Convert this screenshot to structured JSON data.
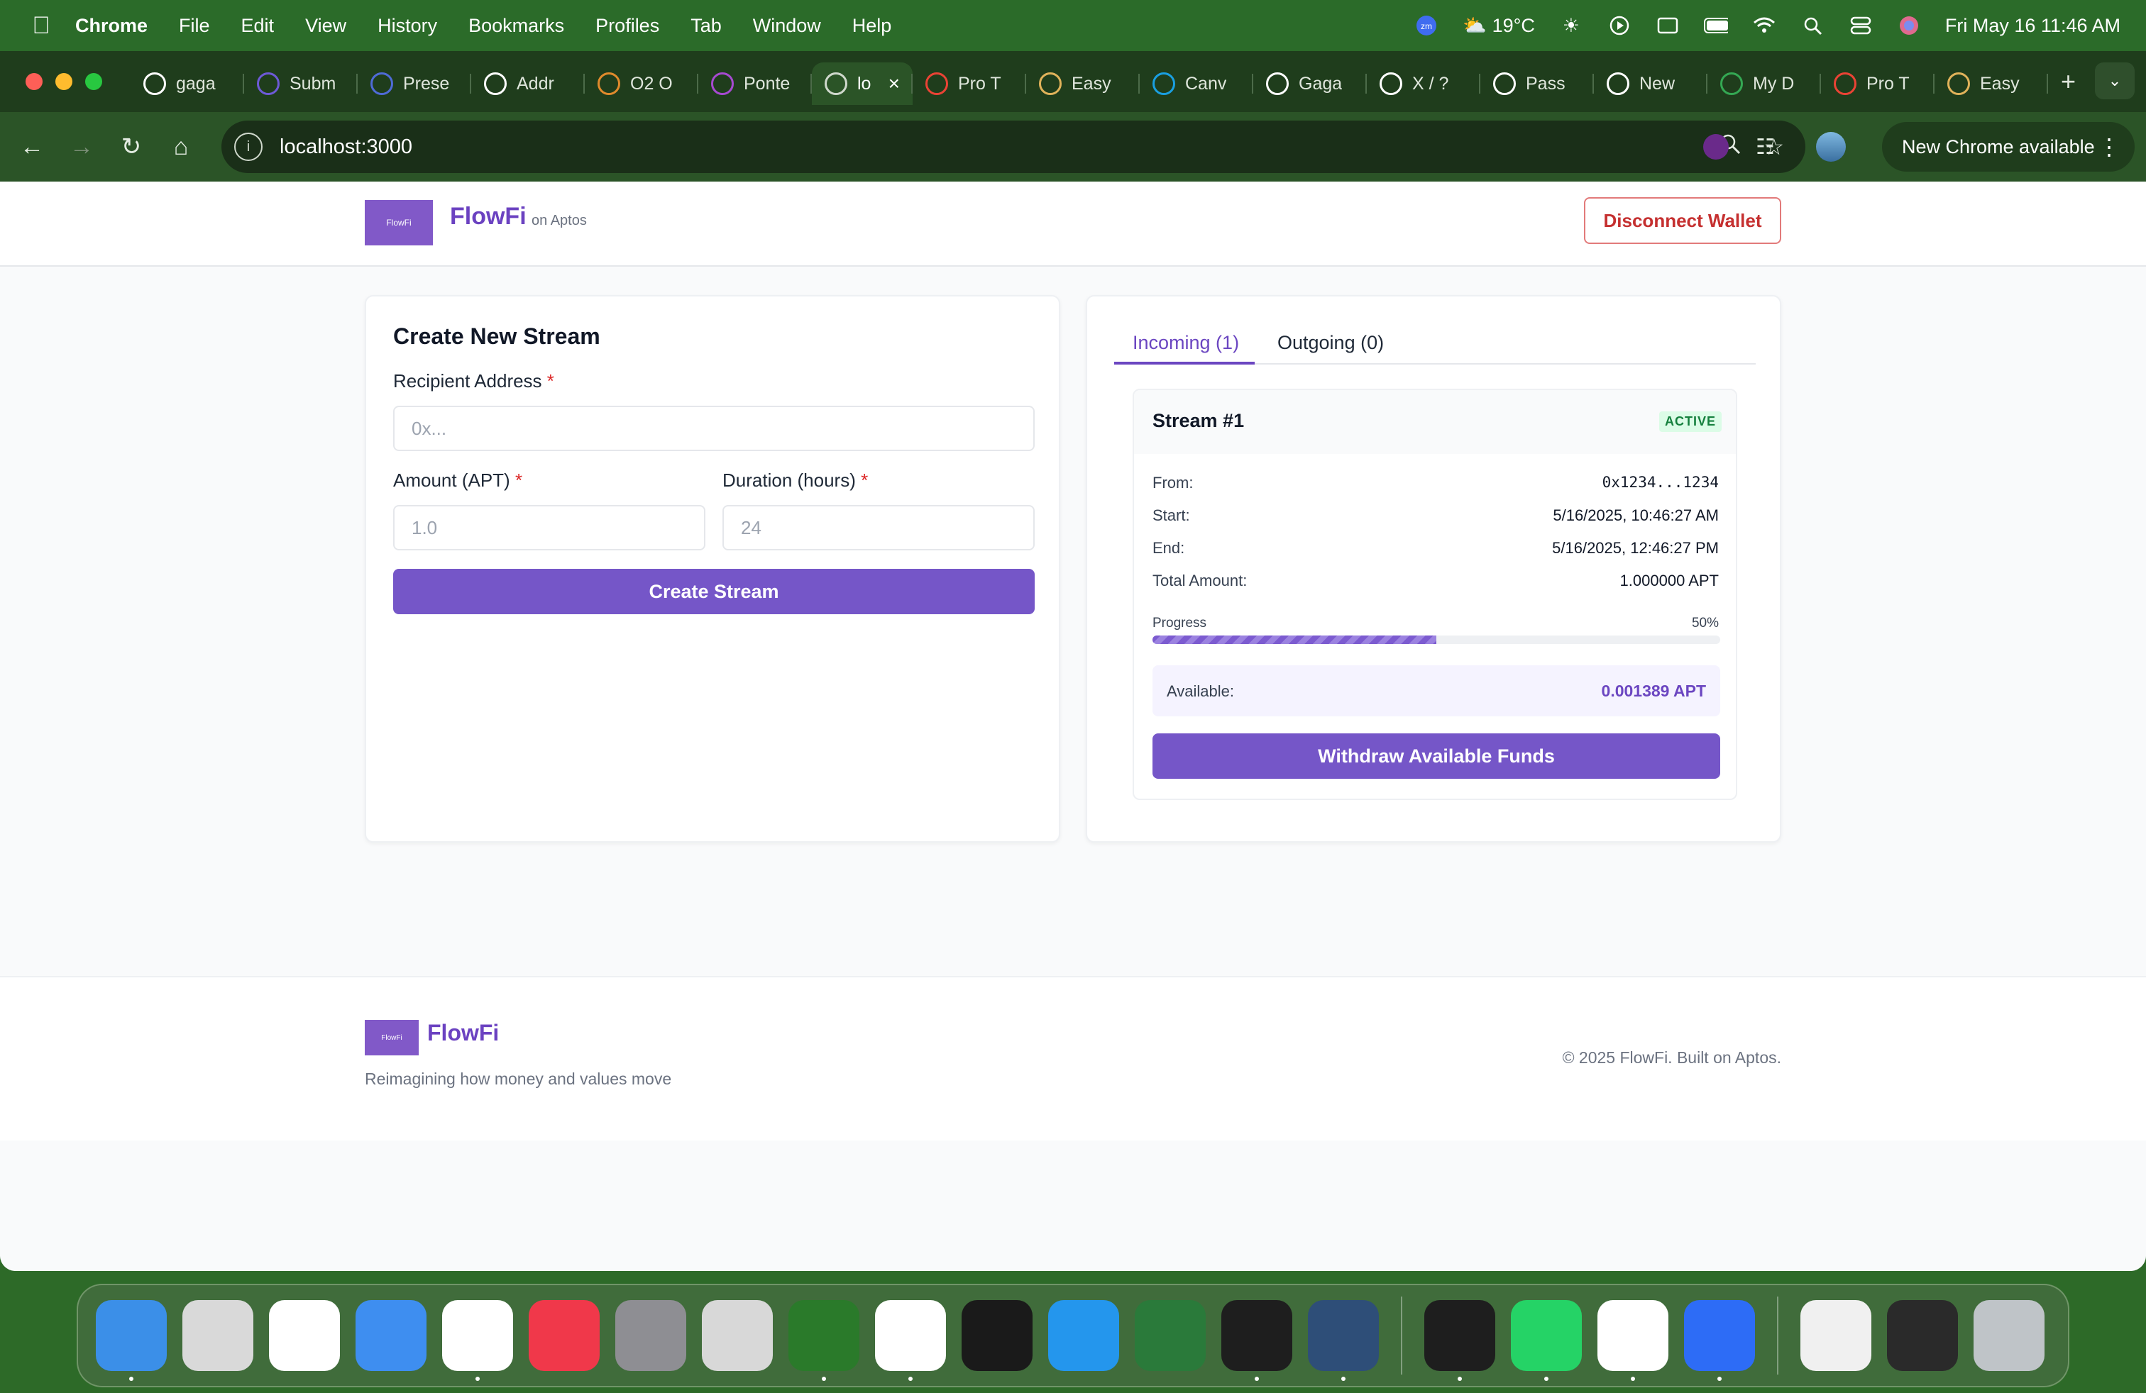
{
  "menubar": {
    "app": "Chrome",
    "items": [
      "File",
      "Edit",
      "View",
      "History",
      "Bookmarks",
      "Profiles",
      "Tab",
      "Window",
      "Help"
    ],
    "weather": "19°C",
    "datetime": "Fri May 16  11:46 AM"
  },
  "tabs": [
    {
      "label": "gaga",
      "icon": "github-icon",
      "color": "#ffffff"
    },
    {
      "label": "Subm",
      "icon": "form-icon",
      "color": "#6d5ad6"
    },
    {
      "label": "Prese",
      "icon": "slides-icon",
      "color": "#4f6bd6"
    },
    {
      "label": "Addr",
      "icon": "address-icon",
      "color": "#ffffff"
    },
    {
      "label": "O2 O",
      "icon": "o2-icon",
      "color": "#e08a2c"
    },
    {
      "label": "Ponte",
      "icon": "ponte-icon",
      "color": "#a64ad0"
    },
    {
      "label": "lo",
      "icon": "globe-icon",
      "color": "#cfd8cc",
      "active": true
    },
    {
      "label": "Pro T",
      "icon": "gmail-icon",
      "color": "#ea4335"
    },
    {
      "label": "Easy",
      "icon": "avatar-icon",
      "color": "#e0b25a"
    },
    {
      "label": "Canv",
      "icon": "canva-icon",
      "color": "#1a9fe0"
    },
    {
      "label": "Gaga",
      "icon": "x-icon",
      "color": "#ffffff"
    },
    {
      "label": "X / ?",
      "icon": "x-icon",
      "color": "#ffffff"
    },
    {
      "label": "Pass",
      "icon": "x-icon",
      "color": "#ffffff"
    },
    {
      "label": "New",
      "icon": "chrome-icon",
      "color": "#ffffff"
    },
    {
      "label": "My D",
      "icon": "drive-icon",
      "color": "#34a853"
    },
    {
      "label": "Pro T",
      "icon": "gmail-icon",
      "color": "#ea4335"
    },
    {
      "label": "Easy",
      "icon": "avatar-icon",
      "color": "#e0b25a"
    }
  ],
  "toolbar": {
    "url": "localhost:3000",
    "update_label": "New Chrome available"
  },
  "header": {
    "brand": "FlowFi",
    "sub": "on Aptos",
    "logo_text": "FlowFi",
    "disconnect_label": "Disconnect Wallet"
  },
  "create": {
    "title": "Create New Stream",
    "recipient_label": "Recipient Address",
    "recipient_placeholder": "0x...",
    "amount_label": "Amount (APT)",
    "amount_placeholder": "1.0",
    "duration_label": "Duration (hours)",
    "duration_placeholder": "24",
    "required_mark": "*",
    "submit_label": "Create Stream"
  },
  "streams": {
    "tab_incoming": "Incoming (1)",
    "tab_outgoing": "Outgoing (0)",
    "item": {
      "title": "Stream #1",
      "status": "ACTIVE",
      "from_label": "From:",
      "from_value": "0x1234...1234",
      "start_label": "Start:",
      "start_value": "5/16/2025, 10:46:27 AM",
      "end_label": "End:",
      "end_value": "5/16/2025, 12:46:27 PM",
      "total_label": "Total Amount:",
      "total_value": "1.000000 APT",
      "progress_label": "Progress",
      "progress_text": "50%",
      "progress_value": 0.5,
      "available_label": "Available:",
      "available_value": "0.001389 APT",
      "withdraw_label": "Withdraw Available Funds"
    }
  },
  "footer": {
    "brand": "FlowFi",
    "tagline": "Reimagining how money and values move",
    "copyright": "© 2025 FlowFi. Built on Aptos."
  },
  "dock": [
    {
      "name": "finder",
      "color": "#3b8fe8"
    },
    {
      "name": "launchpad",
      "color": "#d9d9d9"
    },
    {
      "name": "safari",
      "color": "#ffffff"
    },
    {
      "name": "mail",
      "color": "#3e8ef0"
    },
    {
      "name": "chrome",
      "color": "#ffffff"
    },
    {
      "name": "music",
      "color": "#f0384a"
    },
    {
      "name": "settings",
      "color": "#8e8e93"
    },
    {
      "name": "iphone-mirroring",
      "color": "#d8d8d8"
    },
    {
      "name": "circle-app",
      "color": "#2a7a2a"
    },
    {
      "name": "vscode",
      "color": "#ffffff"
    },
    {
      "name": "headset-app",
      "color": "#1a1a1a"
    },
    {
      "name": "docker",
      "color": "#2496ed"
    },
    {
      "name": "vs-app",
      "color": "#2a7a3a"
    },
    {
      "name": "pycharm",
      "color": "#1e1e1e"
    },
    {
      "name": "mysql-workbench",
      "color": "#2e4e78"
    },
    {
      "name": "terminal",
      "color": "#1e1e1e"
    },
    {
      "name": "whatsapp",
      "color": "#25d366"
    },
    {
      "name": "word",
      "color": "#ffffff"
    },
    {
      "name": "zoom",
      "color": "#2d6cf6"
    },
    {
      "name": "recent-window-1",
      "color": "#f0f0f0"
    },
    {
      "name": "recent-window-2",
      "color": "#2a2a2a"
    },
    {
      "name": "trash",
      "color": "#bfc4c8"
    }
  ]
}
